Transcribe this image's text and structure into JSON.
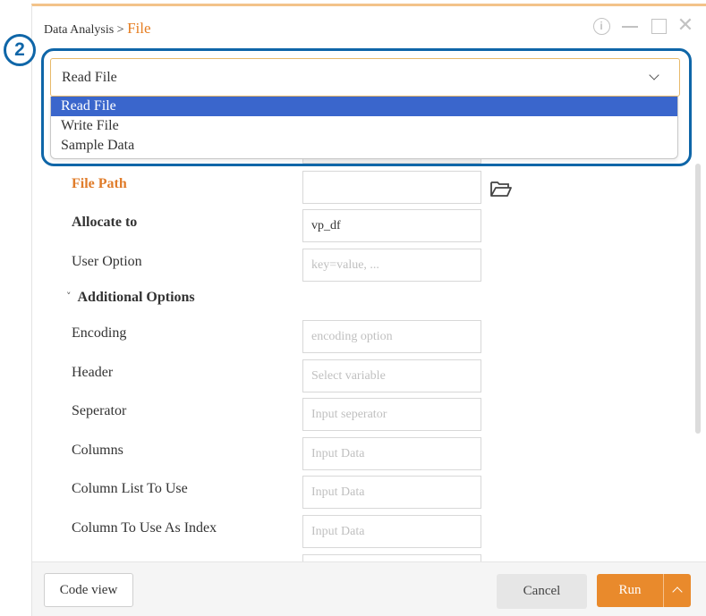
{
  "window": {
    "breadcrumb_parent": "Data Analysis > ",
    "breadcrumb_current": "File",
    "info_glyph": "i",
    "close_glyph": "✕"
  },
  "annotation": {
    "step_number": "2"
  },
  "file_mode": {
    "selected": "Read File",
    "options": [
      "Read File",
      "Write File",
      "Sample Data"
    ]
  },
  "form": {
    "file_path_label": "File Path",
    "allocate_label": "Allocate to",
    "allocate_value": "vp_df",
    "user_option_label": "User Option",
    "user_option_placeholder": "key=value, ..."
  },
  "additional": {
    "toggle_label": "Additional Options",
    "caret": "˅",
    "encoding_label": "Encoding",
    "encoding_placeholder": "encoding option",
    "header_label": "Header",
    "header_placeholder": "Select variable",
    "separator_label": "Seperator",
    "separator_placeholder": "Input seperator",
    "columns_label": "Columns",
    "columns_placeholder": "Input Data",
    "column_list_label": "Column List To Use",
    "column_list_placeholder": "Input Data",
    "index_label": "Column To Use As Index",
    "index_placeholder": "Input Data"
  },
  "footer": {
    "code_view_label": "Code view",
    "cancel_label": "Cancel",
    "run_label": "Run"
  },
  "colors": {
    "accent_orange": "#e98a2c",
    "selection_blue": "#3a66cc",
    "callout_blue": "#0f66a8"
  }
}
